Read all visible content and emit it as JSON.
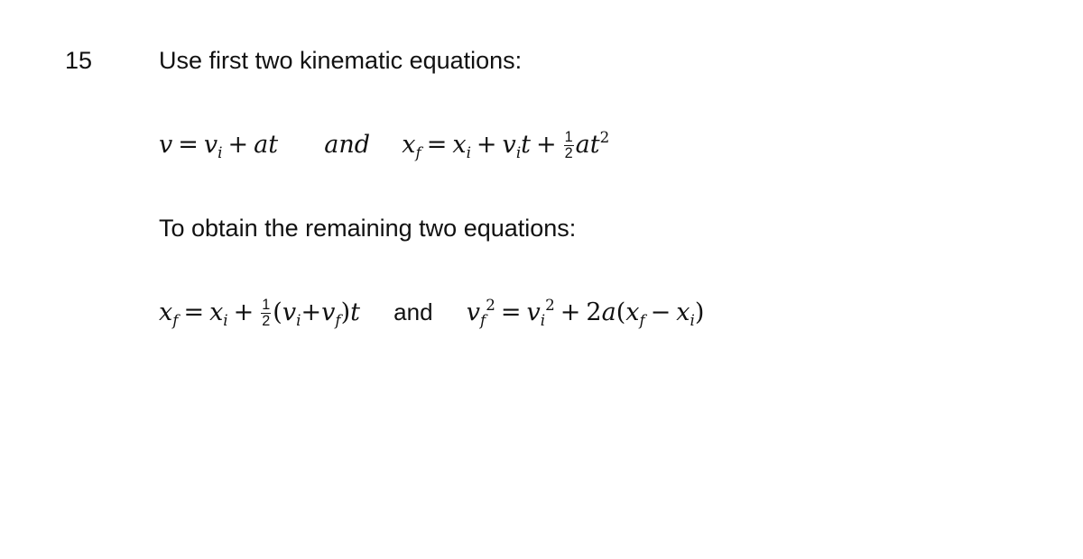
{
  "item_number": "15",
  "intro_text": "Use first two kinematic equations:",
  "given_equations": {
    "eq1": "v = v_i + at",
    "connector": "and",
    "eq2": "x_f = x_i + v_i t + (1/2) a t^2"
  },
  "middle_text": "To obtain the remaining two equations:",
  "derived_equations": {
    "eq3": "x_f = x_i + (1/2)(v_i + v_f) t",
    "connector": "and",
    "eq4": "v_f^2 = v_i^2 + 2a(x_f - x_i)"
  },
  "symbols": {
    "v": "v",
    "x": "x",
    "a": "a",
    "t": "t",
    "i": "i",
    "f": "f",
    "eq": "=",
    "plus": "+",
    "minus": "−",
    "two": "2",
    "one": "1",
    "lparen": "(",
    "rparen": ")"
  }
}
